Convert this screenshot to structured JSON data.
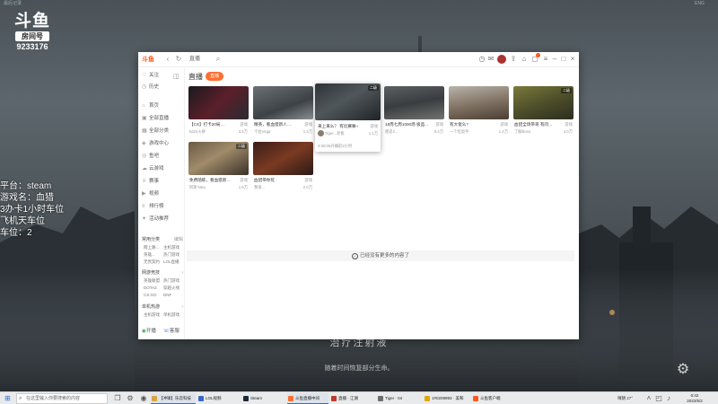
{
  "background": {
    "caption_main": "治疗注射液",
    "caption_sub": "随着时间恢复部分生命。",
    "top_left_faint": "最后记录",
    "top_right_faint": "ENG"
  },
  "logo": {
    "mark": "斗鱼",
    "room_label": "房间号",
    "room_id": "9233176"
  },
  "overlay": {
    "lines": [
      "平台：steam",
      "游戏名：血猎",
      "3办卡1小时车位",
      "飞机天车位",
      "车位：2"
    ]
  },
  "titlebar": {
    "app_logo": "斗鱼",
    "back": "‹",
    "refresh": "↻",
    "crumb": "直播",
    "search_glyph": "⌕"
  },
  "sidebar": {
    "top_items": [
      {
        "label": "关注",
        "icon": "♡"
      },
      {
        "label": "历史",
        "icon": "◷"
      }
    ],
    "nav_items": [
      {
        "label": "首页",
        "icon": "⌂"
      },
      {
        "label": "全部直播",
        "icon": "▣"
      },
      {
        "label": "全部分类",
        "icon": "▦"
      },
      {
        "label": "游戏中心",
        "icon": "◈"
      },
      {
        "label": "鱼吧",
        "icon": "◎"
      },
      {
        "label": "云游戏",
        "icon": "☁"
      },
      {
        "label": "赛事",
        "icon": "♕"
      },
      {
        "label": "视频",
        "icon": "▶"
      },
      {
        "label": "排行榜",
        "icon": "≡"
      },
      {
        "label": "活动推荐",
        "icon": "✦"
      }
    ],
    "groups": [
      {
        "title": "常用分类",
        "more": "编辑",
        "cells": [
          "网上路...",
          "主机游戏",
          "英雄...",
          "热门游戏",
          "无畏契约",
          "LOL直播"
        ]
      },
      {
        "title": "网游竞技",
        "more": "›",
        "cells": [
          "英雄联盟",
          "热门游戏",
          "DOTA2",
          "穿越火线",
          "CS:GO",
          "DNF"
        ]
      },
      {
        "title": "单机热游",
        "more": "›",
        "cells": [
          "主机游戏",
          "单机游戏"
        ]
      }
    ],
    "bottom_items": [
      {
        "label": "开播",
        "icon": "◉"
      },
      {
        "label": "客服",
        "icon": "☏"
      }
    ]
  },
  "main": {
    "title": "直播",
    "live_pill": "直播",
    "end_text": "已经没有更多的内容了",
    "cards": [
      {
        "title": "【CS】打卡20局…",
        "cat": "游戏",
        "anchor": "kd24火拼",
        "heat": "3.4万",
        "tag": ""
      },
      {
        "title": "精英，看血猎新人…",
        "cat": "游戏",
        "anchor": "卡拉Vega",
        "heat": "1.3万",
        "tag": ""
      },
      {
        "title": "来上来么？ 有比赛嘛~",
        "cat": "游戏",
        "anchor": "Tiger...老板",
        "heat": "1.1万",
        "tag": "二级",
        "time": "4:00:05开播前2小时"
      },
      {
        "title": "18周七周1000场 极品…",
        "cat": "游戏",
        "anchor": "肥皂2...",
        "heat": "9.4万",
        "tag": ""
      },
      {
        "title": "有大佬么?",
        "cat": "游戏",
        "anchor": "一个吃饭手",
        "heat": "1.4万",
        "tag": ""
      },
      {
        "title": "血猎全场带哥 有问…",
        "cat": "游戏",
        "anchor": "了解Boss",
        "heat": "4.0万",
        "tag": "二级"
      },
      {
        "title": "免费陪练，看血猎新…",
        "cat": "游戏",
        "anchor": "阿斯Yaku",
        "heat": "1.6万",
        "tag": "二级"
      },
      {
        "title": "血猎带你玩",
        "cat": "游戏",
        "anchor": "我很...",
        "heat": "2.0万",
        "tag": ""
      }
    ]
  },
  "taskbar": {
    "search_placeholder": "在这里输入你要搜索的内容",
    "apps": [
      {
        "label": "【冲锋】乐云科技",
        "color": "#d9a441"
      },
      {
        "label": "LOL视频",
        "color": "#3a66c9"
      },
      {
        "label": "Steam",
        "color": "#1b2838"
      },
      {
        "label": "斗鱼直播中间",
        "color": "#ff6d2e"
      },
      {
        "label": "直播 · 江湖",
        "color": "#c0392b"
      },
      {
        "label": "Tiger · 04",
        "color": "#6d6d6d"
      },
      {
        "label": "1#0209993 · 美和",
        "color": "#e0a800"
      },
      {
        "label": "斗鱼客户端",
        "color": "#ff5a1e"
      }
    ],
    "tray_text": "晴朗 27°",
    "clock_time": "0:42",
    "clock_date": "2022/5/2"
  }
}
